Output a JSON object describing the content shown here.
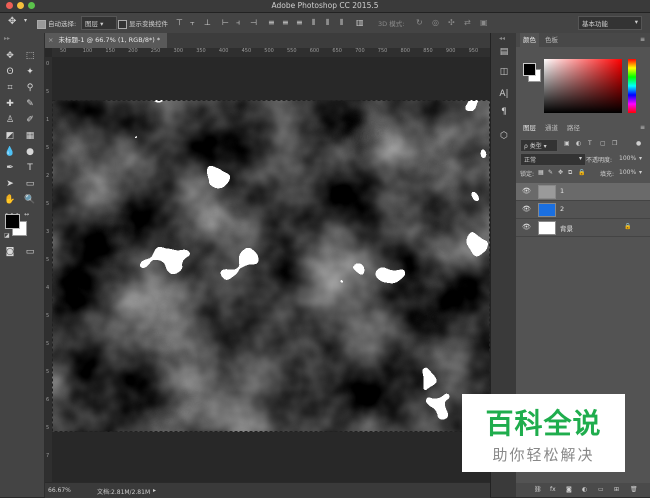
{
  "window": {
    "title": "Adobe Photoshop CC 2015.5"
  },
  "options_bar": {
    "auto_select_label": "自动选择:",
    "auto_select_value": "图层",
    "show_transform_label": "显示变换控件",
    "mode_3d_label": "3D 模式:",
    "workspace": "基本功能"
  },
  "document": {
    "tab_label": "未标题-1 @ 66.7% (1, RGB/8*) *",
    "zoom": "66.67%",
    "doc_size": "文档:2.81M/2.81M"
  },
  "ruler": {
    "top": [
      "50",
      "100",
      "150",
      "200",
      "250",
      "300",
      "350",
      "400",
      "450",
      "500",
      "550",
      "600",
      "650",
      "700",
      "750",
      "800",
      "850",
      "900",
      "950"
    ],
    "left": [
      "0",
      "5",
      "1",
      "5",
      "2",
      "5",
      "3",
      "5",
      "4",
      "5",
      "5",
      "5",
      "6",
      "5",
      "7"
    ]
  },
  "color_panel": {
    "tabs": [
      "颜色",
      "色板"
    ],
    "fg_color": "#000000",
    "bg_color": "#ffffff"
  },
  "layers_panel": {
    "tabs": [
      "图层",
      "通道",
      "路径"
    ],
    "filter_kind": "ρ 类型",
    "blend_mode": "正常",
    "opacity_label": "不透明度:",
    "opacity_value": "100%",
    "lock_label": "锁定:",
    "fill_label": "填充:",
    "fill_value": "100%",
    "layers": [
      {
        "name": "1",
        "thumb_color": "#9a9a9a",
        "selected": true
      },
      {
        "name": "2",
        "thumb_color": "#1a6fe0",
        "selected": false
      },
      {
        "name": "背景",
        "thumb_color": "#ffffff",
        "selected": false
      }
    ]
  },
  "watermark": {
    "title": "百科全说",
    "subtitle": "助你轻松解决"
  }
}
